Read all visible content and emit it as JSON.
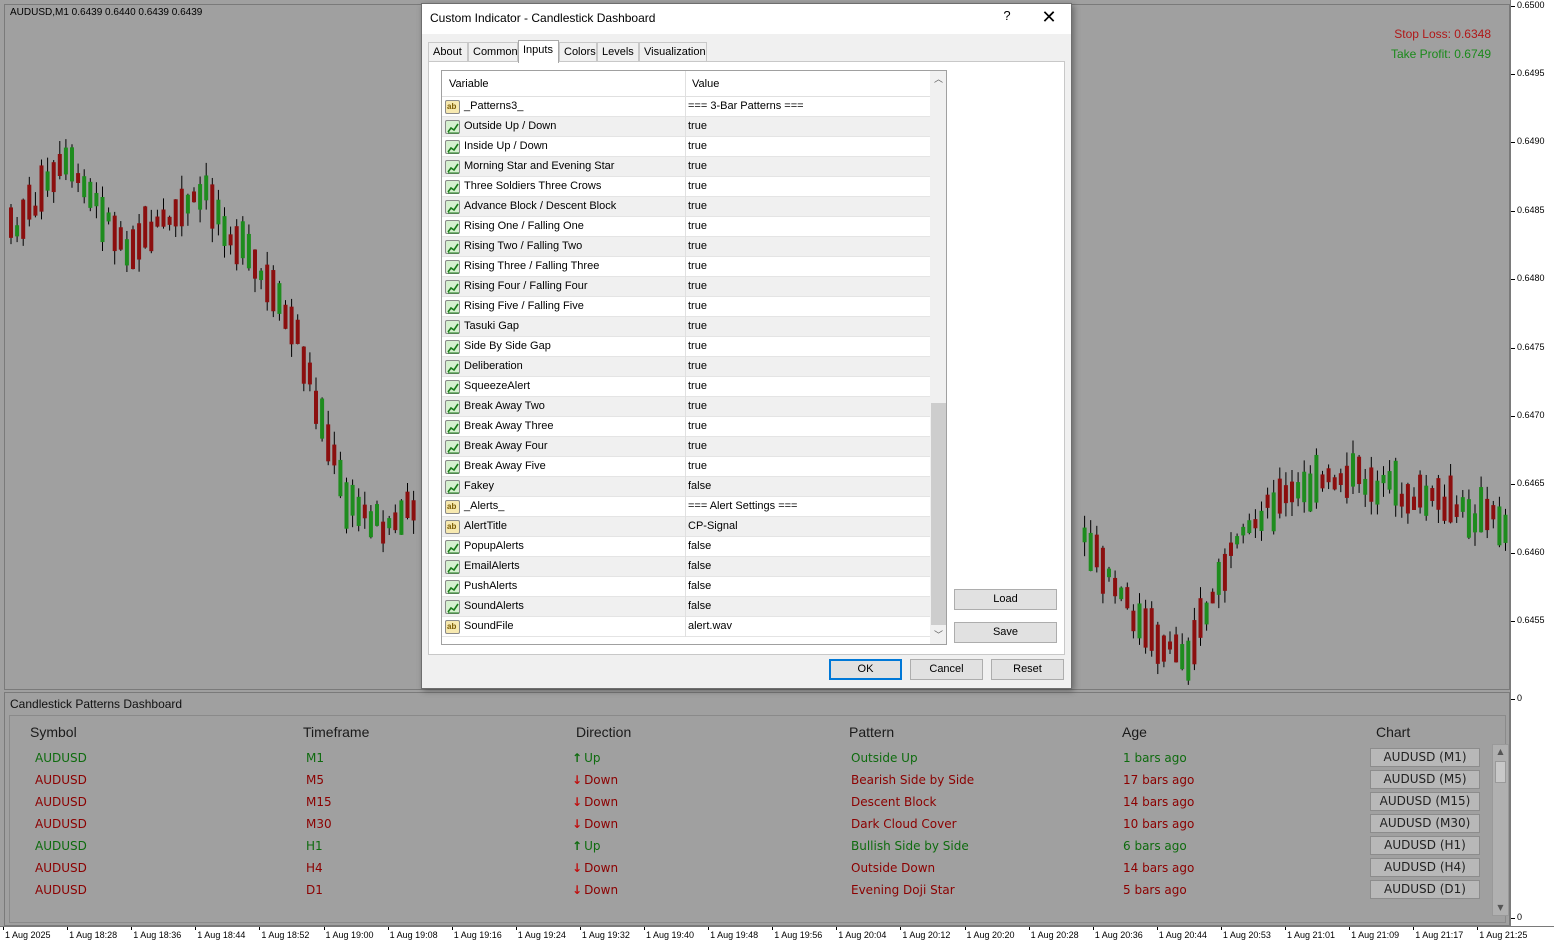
{
  "chart": {
    "symbol_line": "AUDUSD,M1  0.6439 0.6440 0.6439 0.6439",
    "stop_loss": "Stop Loss: 0.6348",
    "take_profit": "Take Profit: 0.6749",
    "price_labels": [
      "0.6500",
      "0.6495",
      "0.6490",
      "0.6485",
      "0.6480",
      "0.6475",
      "0.6470",
      "0.6465",
      "0.6460",
      "0.6455",
      "0",
      "0"
    ],
    "time_labels": [
      "1 Aug 2025",
      "1 Aug 18:28",
      "1 Aug 18:36",
      "1 Aug 18:44",
      "1 Aug 18:52",
      "1 Aug 19:00",
      "1 Aug 19:08",
      "1 Aug 19:16",
      "1 Aug 19:24",
      "1 Aug 19:32",
      "1 Aug 19:40",
      "1 Aug 19:48",
      "1 Aug 19:56",
      "1 Aug 20:04",
      "1 Aug 20:12",
      "1 Aug 20:20",
      "1 Aug 20:28",
      "1 Aug 20:36",
      "1 Aug 20:44",
      "1 Aug 20:53",
      "1 Aug 21:01",
      "1 Aug 21:09",
      "1 Aug 21:17",
      "1 Aug 21:25"
    ],
    "colors": {
      "bull": "#1e8c1e",
      "bear": "#8b0f0f",
      "wick": "#000000",
      "background": "#a0a0a0"
    }
  },
  "dashboard": {
    "title": "Candlestick Patterns Dashboard",
    "headers": {
      "symbol": "Symbol",
      "timeframe": "Timeframe",
      "direction": "Direction",
      "pattern": "Pattern",
      "age": "Age",
      "chart": "Chart"
    },
    "rows": [
      {
        "symbol": "AUDUSD",
        "timeframe": "M1",
        "direction": "Up",
        "dir": "up",
        "pattern": "Outside Up",
        "age": "1 bars ago",
        "chart": "AUDUSD (M1)"
      },
      {
        "symbol": "AUDUSD",
        "timeframe": "M5",
        "direction": "Down",
        "dir": "down",
        "pattern": "Bearish Side by Side",
        "age": "17 bars ago",
        "chart": "AUDUSD (M5)"
      },
      {
        "symbol": "AUDUSD",
        "timeframe": "M15",
        "direction": "Down",
        "dir": "down",
        "pattern": "Descent Block",
        "age": "14 bars ago",
        "chart": "AUDUSD (M15)"
      },
      {
        "symbol": "AUDUSD",
        "timeframe": "M30",
        "direction": "Down",
        "dir": "down",
        "pattern": "Dark Cloud Cover",
        "age": "10 bars ago",
        "chart": "AUDUSD (M30)"
      },
      {
        "symbol": "AUDUSD",
        "timeframe": "H1",
        "direction": "Up",
        "dir": "up",
        "pattern": "Bullish Side by Side",
        "age": "6 bars ago",
        "chart": "AUDUSD (H1)"
      },
      {
        "symbol": "AUDUSD",
        "timeframe": "H4",
        "direction": "Down",
        "dir": "down",
        "pattern": "Outside Down",
        "age": "14 bars ago",
        "chart": "AUDUSD (H4)"
      },
      {
        "symbol": "AUDUSD",
        "timeframe": "D1",
        "direction": "Down",
        "dir": "down",
        "pattern": "Evening Doji Star",
        "age": "5 bars ago",
        "chart": "AUDUSD (D1)"
      }
    ]
  },
  "dialog": {
    "title": "Custom Indicator - Candlestick Dashboard",
    "help": "?",
    "close": "✕",
    "tabs": [
      "About",
      "Common",
      "Inputs",
      "Colors",
      "Levels",
      "Visualization"
    ],
    "active_tab": "Inputs",
    "grid_headers": {
      "variable": "Variable",
      "value": "Value"
    },
    "inputs": [
      {
        "type": "str",
        "name": "_Patterns3_",
        "value": "=== 3-Bar Patterns ==="
      },
      {
        "type": "bool",
        "name": "Outside Up / Down",
        "value": "true"
      },
      {
        "type": "bool",
        "name": "Inside Up / Down",
        "value": "true"
      },
      {
        "type": "bool",
        "name": "Morning Star and Evening Star",
        "value": "true"
      },
      {
        "type": "bool",
        "name": "Three Soldiers Three Crows",
        "value": "true"
      },
      {
        "type": "bool",
        "name": "Advance Block / Descent Block",
        "value": "true"
      },
      {
        "type": "bool",
        "name": "Rising One / Falling One",
        "value": "true"
      },
      {
        "type": "bool",
        "name": "Rising Two / Falling Two",
        "value": "true"
      },
      {
        "type": "bool",
        "name": "Rising Three / Falling Three",
        "value": "true"
      },
      {
        "type": "bool",
        "name": "Rising Four / Falling Four",
        "value": "true"
      },
      {
        "type": "bool",
        "name": "Rising Five / Falling Five",
        "value": "true"
      },
      {
        "type": "bool",
        "name": "Tasuki Gap",
        "value": "true"
      },
      {
        "type": "bool",
        "name": "Side By Side Gap",
        "value": "true"
      },
      {
        "type": "bool",
        "name": "Deliberation",
        "value": "true"
      },
      {
        "type": "bool",
        "name": "SqueezeAlert",
        "value": "true"
      },
      {
        "type": "bool",
        "name": "Break Away Two",
        "value": "true"
      },
      {
        "type": "bool",
        "name": "Break Away Three",
        "value": "true"
      },
      {
        "type": "bool",
        "name": "Break Away Four",
        "value": "true"
      },
      {
        "type": "bool",
        "name": "Break Away Five",
        "value": "true"
      },
      {
        "type": "bool",
        "name": "Fakey",
        "value": "false"
      },
      {
        "type": "str",
        "name": "_Alerts_",
        "value": "=== Alert Settings ==="
      },
      {
        "type": "str",
        "name": "AlertTitle",
        "value": "CP-Signal"
      },
      {
        "type": "bool",
        "name": "PopupAlerts",
        "value": "false"
      },
      {
        "type": "bool",
        "name": "EmailAlerts",
        "value": "false"
      },
      {
        "type": "bool",
        "name": "PushAlerts",
        "value": "false"
      },
      {
        "type": "bool",
        "name": "SoundAlerts",
        "value": "false"
      },
      {
        "type": "str",
        "name": "SoundFile",
        "value": "alert.wav"
      }
    ],
    "buttons": {
      "load": "Load",
      "save": "Save",
      "ok": "OK",
      "cancel": "Cancel",
      "reset": "Reset"
    }
  }
}
